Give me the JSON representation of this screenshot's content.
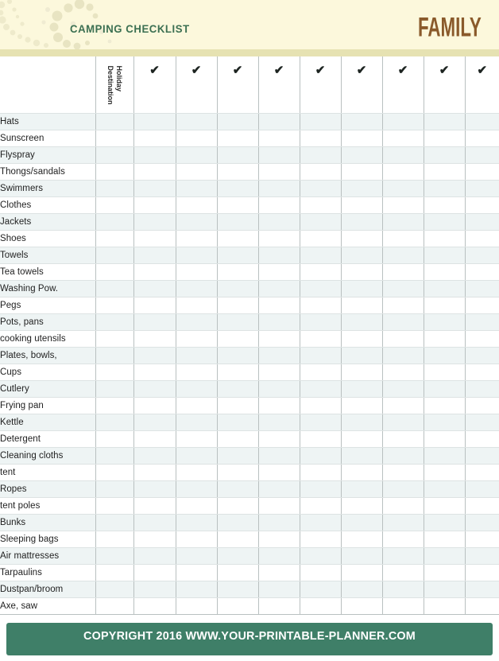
{
  "header": {
    "title": "CAMPING CHECKLIST",
    "brand": "FAMILY",
    "title_color": "#3c7052",
    "brand_color": "#8a5a2b",
    "background_color": "#fcf8dc",
    "band_color": "#e6e2b2",
    "decoration": "dotted-arc-pattern"
  },
  "table": {
    "name_column_header": "",
    "destination_column": {
      "line1": "Holiday",
      "line2": "Destination"
    },
    "check_icon": "✔",
    "check_column_count": 9,
    "row_stripe_color": "#eef4f4",
    "row_alt_color": "#ffffff",
    "grid_line_color": "#b9c0c0",
    "items": [
      "Hats",
      "Sunscreen",
      "Flyspray",
      "Thongs/sandals",
      "Swimmers",
      "Clothes",
      "Jackets",
      "Shoes",
      "Towels",
      "Tea towels",
      "Washing Pow.",
      "Pegs",
      "Pots, pans",
      "cooking utensils",
      "Plates, bowls,",
      "Cups",
      "Cutlery",
      "Frying pan",
      "Kettle",
      "Detergent",
      "Cleaning cloths",
      "tent",
      "Ropes",
      "tent poles",
      "Bunks",
      "Sleeping bags",
      "Air mattresses",
      "Tarpaulins",
      "Dustpan/broom",
      "Axe, saw"
    ]
  },
  "footer": {
    "text": "COPYRIGHT 2016  WWW.YOUR-PRINTABLE-PLANNER.COM",
    "background_color": "#3f7f68",
    "text_color": "#ffffff"
  }
}
